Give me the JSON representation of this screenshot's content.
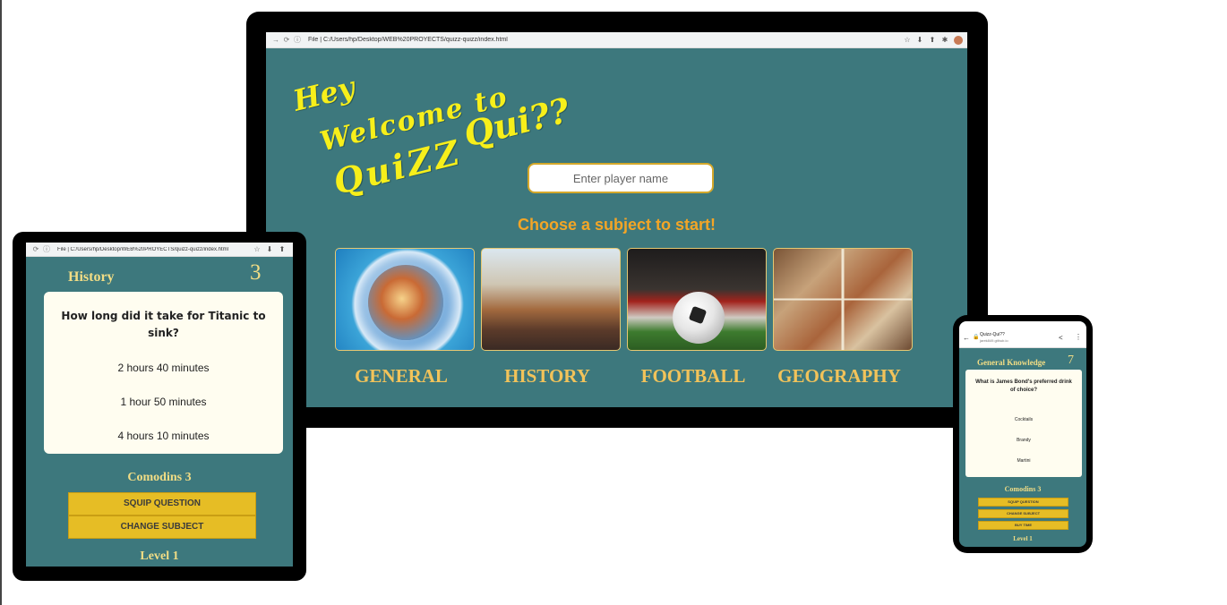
{
  "desktop": {
    "browser": {
      "back_icon": "arrow-right",
      "reload_icon": "reload",
      "url": "File | C:/Users/hp/Desktop/WEB%20PROYECTS/quizz-quizz/index.html",
      "extension_icons": [
        "star-icon",
        "extension-icon",
        "upload-icon",
        "puzzle-icon"
      ]
    },
    "welcome": {
      "line1": "Hey",
      "line2": "Welcome to",
      "line3a": "QuiZZ",
      "line3b": "Qui??"
    },
    "player_input": {
      "placeholder": "Enter player name"
    },
    "choose_title": "Choose a subject to start!",
    "subjects": [
      {
        "label": "GENERAL"
      },
      {
        "label": "HISTORY"
      },
      {
        "label": "FOOTBALL"
      },
      {
        "label": "GEOGRAPHY"
      }
    ],
    "colors": {
      "background": "#3d787d",
      "accent": "#f3a526",
      "title_yellow": "#f7ef1a"
    }
  },
  "tablet": {
    "browser": {
      "url": "File | C:/Users/hp/Desktop/WEB%20PROYECTS/quizz-quizz/index.html"
    },
    "subject": "History",
    "score": "3",
    "question": "How long did it take for Titanic to sink?",
    "answers": [
      "2 hours 40 minutes",
      "1 hour 50 minutes",
      "4 hours 10 minutes"
    ],
    "comodins": "Comodins 3",
    "buttons": {
      "skip": "SQUIP QUESTION",
      "change": "CHANGE SUBJECT"
    },
    "level": "Level 1"
  },
  "phone": {
    "browser": {
      "site_title": "Quizz-Qui??",
      "site_sub": "jarek849.github.io"
    },
    "subject": "General Knowledge",
    "score": "7",
    "question": "What is James Bond's preferred drink of choice?",
    "answers": [
      "Cocktails",
      "Brandy",
      "Martini"
    ],
    "comodins": "Comodins 3",
    "buttons": {
      "skip": "SQUIP QUESTION",
      "change": "CHANGE SUBJECT",
      "buy": "BUY TIME"
    },
    "level": "Level 1"
  }
}
